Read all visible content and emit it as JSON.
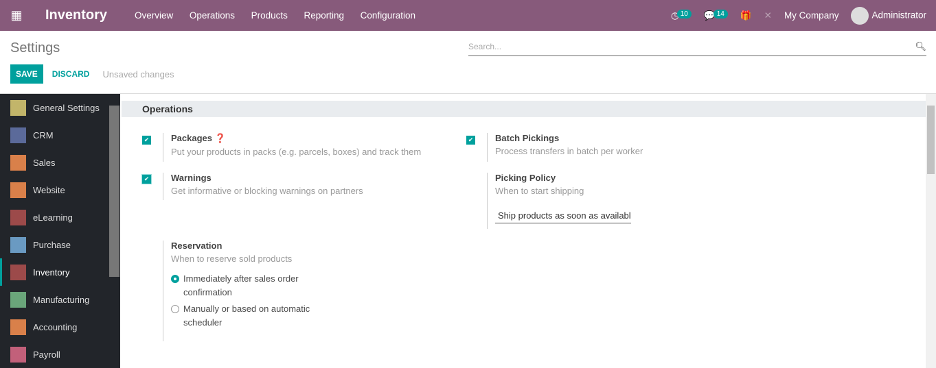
{
  "nav": {
    "app": "Inventory",
    "menu": [
      "Overview",
      "Operations",
      "Products",
      "Reporting",
      "Configuration"
    ],
    "activity_count": "10",
    "message_count": "14",
    "company": "My Company",
    "user": "Administrator"
  },
  "control": {
    "title": "Settings",
    "search_placeholder": "Search...",
    "save": "SAVE",
    "discard": "DISCARD",
    "status": "Unsaved changes"
  },
  "sidebar": {
    "items": [
      {
        "label": "General Settings",
        "color": "#c2b56a"
      },
      {
        "label": "CRM",
        "color": "#5b6a9a"
      },
      {
        "label": "Sales",
        "color": "#d9804a"
      },
      {
        "label": "Website",
        "color": "#d9804a"
      },
      {
        "label": "eLearning",
        "color": "#9c4a4a"
      },
      {
        "label": "Purchase",
        "color": "#6a9ac2"
      },
      {
        "label": "Inventory",
        "color": "#9c4a4a"
      },
      {
        "label": "Manufacturing",
        "color": "#6aa57a"
      },
      {
        "label": "Accounting",
        "color": "#d9804a"
      },
      {
        "label": "Payroll",
        "color": "#c2607a"
      }
    ],
    "active": "Inventory"
  },
  "section": "Operations",
  "settings": {
    "packages": {
      "label": "Packages",
      "desc": "Put your products in packs (e.g. parcels, boxes) and track them",
      "checked": true
    },
    "batch": {
      "label": "Batch Pickings",
      "desc": "Process transfers in batch per worker",
      "checked": true
    },
    "warnings": {
      "label": "Warnings",
      "desc": "Get informative or blocking warnings on partners",
      "checked": true
    },
    "picking": {
      "label": "Picking Policy",
      "desc": "When to start shipping",
      "value": "Ship products as soon as available"
    },
    "reservation": {
      "label": "Reservation",
      "desc": "When to reserve sold products",
      "options": [
        "Immediately after sales order confirmation",
        "Manually or based on automatic scheduler"
      ],
      "selected": 0
    }
  }
}
